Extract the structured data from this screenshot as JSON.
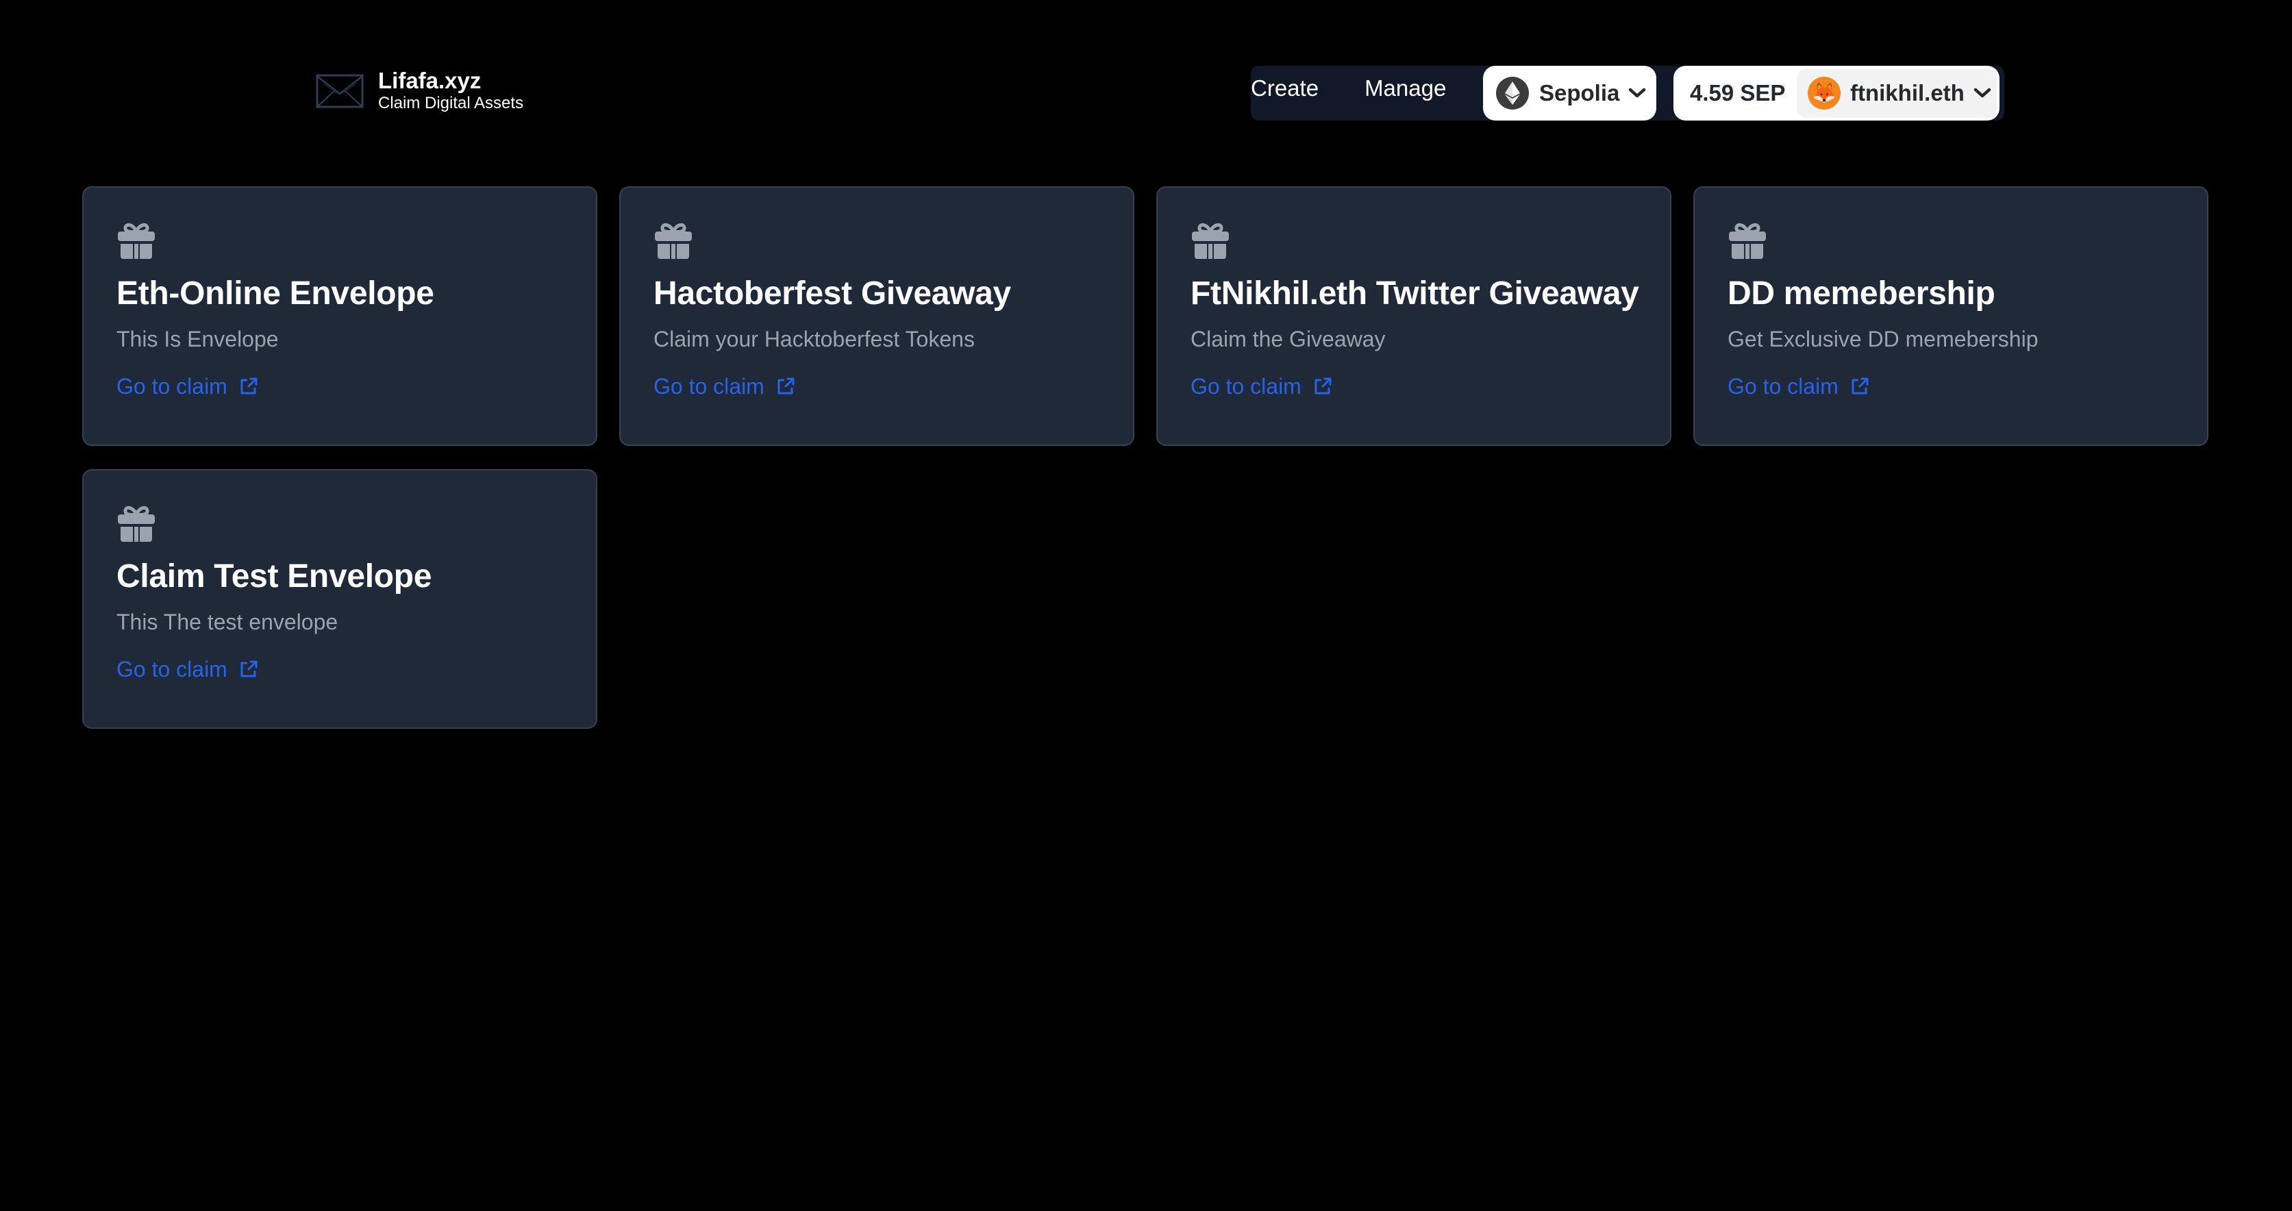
{
  "header": {
    "brand": {
      "title": "Lifafa.xyz",
      "subtitle": "Claim Digital Assets",
      "logo_icon": "envelope-icon"
    },
    "nav": {
      "links": [
        {
          "label": "Create"
        },
        {
          "label": "Manage"
        }
      ]
    },
    "wallet": {
      "chain": {
        "name": "Sepolia",
        "icon": "ethereum-icon"
      },
      "balance": "4.59 SEP",
      "account": {
        "name": "ftnikhil.eth",
        "avatar_emoji": "🦊",
        "avatar_color": "#f6851b"
      }
    }
  },
  "colors": {
    "background": "#000000",
    "card_background": "#1f2937",
    "card_border": "#374151",
    "link": "#2563eb",
    "muted_text": "#9ca3af",
    "nav_background": "#111827"
  },
  "envelopes": [
    {
      "title": "Eth-Online Envelope",
      "description": "This Is Envelope",
      "link_label": "Go to claim",
      "icon": "gift-icon"
    },
    {
      "title": "Hactoberfest Giveaway",
      "description": "Claim your Hacktoberfest Tokens",
      "link_label": "Go to claim",
      "icon": "gift-icon"
    },
    {
      "title": "FtNikhil.eth Twitter Giveaway",
      "description": "Claim the Giveaway",
      "link_label": "Go to claim",
      "icon": "gift-icon"
    },
    {
      "title": "DD memebership",
      "description": "Get Exclusive DD memebership",
      "link_label": "Go to claim",
      "icon": "gift-icon"
    },
    {
      "title": "Claim Test Envelope",
      "description": "This The test envelope",
      "link_label": "Go to claim",
      "icon": "gift-icon"
    }
  ]
}
